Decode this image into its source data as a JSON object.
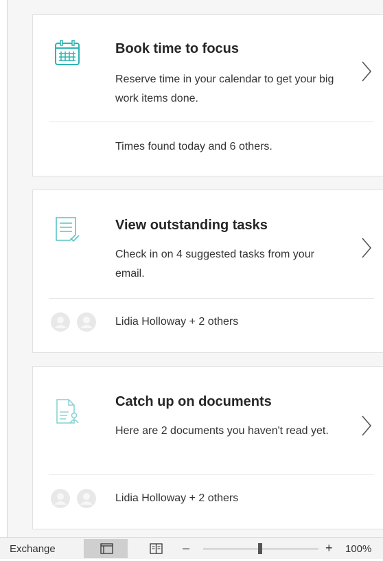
{
  "cards": [
    {
      "title": "Book time to focus",
      "description": "Reserve time in your calendar to get your big work items done.",
      "footer": "Times found today and 6 others."
    },
    {
      "title": "View outstanding tasks",
      "description": "Check in on 4 suggested tasks from your email.",
      "footer": "Lidia Holloway + 2 others"
    },
    {
      "title": "Catch up on documents",
      "description": "Here are 2 documents you haven't read yet.",
      "footer": "Lidia Holloway + 2 others"
    }
  ],
  "icons": {
    "card1": "calendar-icon",
    "card2": "task-list-icon",
    "card3": "document-person-icon",
    "accent": "#2bb5b5"
  },
  "statusbar": {
    "account": "Exchange",
    "zoom_minus": "–",
    "zoom_plus": "+",
    "zoom_level": "100%"
  }
}
